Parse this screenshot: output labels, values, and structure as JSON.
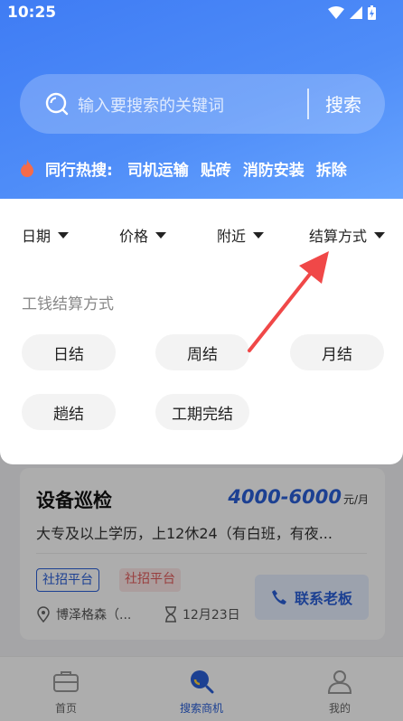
{
  "status_bar": {
    "time": "10:25"
  },
  "search": {
    "placeholder": "输入要搜索的关键词",
    "button_label": "搜索"
  },
  "hot_search": {
    "label": "同行热搜:",
    "items": [
      "司机运输",
      "贴砖",
      "消防安装",
      "拆除"
    ]
  },
  "filters": {
    "tabs": [
      "日期",
      "价格",
      "附近",
      "结算方式"
    ],
    "section_title": "工钱结算方式",
    "options": [
      "日结",
      "周结",
      "月结",
      "趟结",
      "工期完结"
    ]
  },
  "job_card": {
    "title": "设备巡检",
    "salary": "4000-6000",
    "salary_unit": "元/月",
    "description": "大专及以上学历，上12休24（有白班，有夜...",
    "tags": [
      "社招平台",
      "社招平台"
    ],
    "contact_label": "联系老板",
    "company": "博泽格森（...",
    "date": "12月23日"
  },
  "bottom_nav": {
    "items": [
      "首页",
      "搜索商机",
      "我的"
    ]
  },
  "colors": {
    "primary": "#2a5fd8",
    "header": "#4f8df8",
    "annotation_arrow": "#f04848"
  }
}
